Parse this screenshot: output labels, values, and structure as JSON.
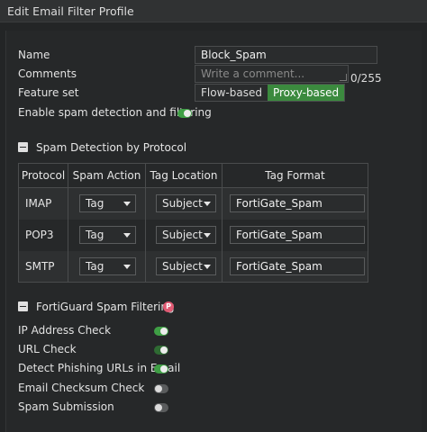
{
  "window": {
    "title": "Edit Email Filter Profile"
  },
  "form": {
    "name_label": "Name",
    "name_value": "Block_Spam",
    "comments_label": "Comments",
    "comments_placeholder": "Write a comment...",
    "comments_counter": "0/255",
    "feature_set_label": "Feature set",
    "feature_set_options": [
      "Flow-based",
      "Proxy-based"
    ],
    "feature_set_selected": "Proxy-based",
    "enable_spam_label": "Enable spam detection and filtering",
    "enable_spam_on": true
  },
  "protocol_section": {
    "title": "Spam Detection by Protocol",
    "columns": [
      "Protocol",
      "Spam Action",
      "Tag Location",
      "Tag Format"
    ],
    "rows": [
      {
        "protocol": "IMAP",
        "action": "Tag",
        "location": "Subject",
        "format": "FortiGate_Spam"
      },
      {
        "protocol": "POP3",
        "action": "Tag",
        "location": "Subject",
        "format": "FortiGate_Spam"
      },
      {
        "protocol": "SMTP",
        "action": "Tag",
        "location": "Subject",
        "format": "FortiGate_Spam"
      }
    ]
  },
  "fortiguard_section": {
    "title": "FortiGuard Spam Filtering",
    "badge": "P",
    "items": [
      {
        "label": "IP Address Check",
        "on": true
      },
      {
        "label": "URL Check",
        "on": true
      },
      {
        "label": "Detect Phishing URLs in Email",
        "on": true
      },
      {
        "label": "Email Checksum Check",
        "on": false
      },
      {
        "label": "Spam Submission",
        "on": false
      }
    ]
  },
  "colors": {
    "accent_green": "#3f9f45",
    "selected_segment": "#3b8a3e",
    "badge_pink": "#e05a73",
    "background": "#232526"
  }
}
